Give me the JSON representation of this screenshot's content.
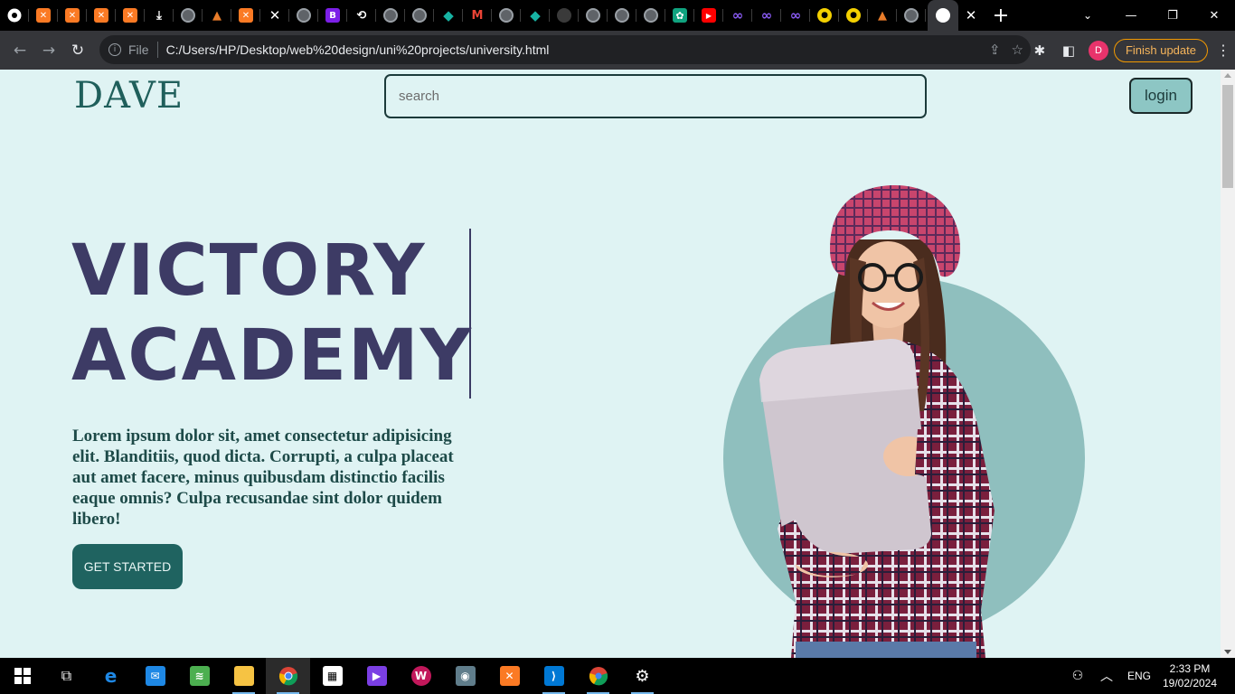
{
  "browser": {
    "tabs": [
      {
        "icon": "chrome-icon"
      },
      {
        "icon": "xampp-icon"
      },
      {
        "icon": "xampp-icon"
      },
      {
        "icon": "xampp-icon"
      },
      {
        "icon": "xampp-icon"
      },
      {
        "icon": "download-icon"
      },
      {
        "icon": "globe-icon"
      },
      {
        "icon": "matlab-icon"
      },
      {
        "icon": "xampp-icon"
      },
      {
        "icon": "x-icon"
      },
      {
        "icon": "globe-icon"
      },
      {
        "icon": "bootstrap-icon",
        "glyph": "B"
      },
      {
        "icon": "history-icon"
      },
      {
        "icon": "globe-icon"
      },
      {
        "icon": "globe-icon"
      },
      {
        "icon": "teal-diamond-icon"
      },
      {
        "icon": "gmail-icon",
        "glyph": "M"
      },
      {
        "icon": "globe-icon"
      },
      {
        "icon": "teal-diamond-icon"
      },
      {
        "icon": "github-icon"
      },
      {
        "icon": "globe-icon"
      },
      {
        "icon": "globe-icon"
      },
      {
        "icon": "globe-icon"
      },
      {
        "icon": "chatgpt-icon"
      },
      {
        "icon": "youtube-icon"
      },
      {
        "icon": "infinity-icon"
      },
      {
        "icon": "infinity-icon"
      },
      {
        "icon": "infinity-icon"
      },
      {
        "icon": "owl-icon"
      },
      {
        "icon": "owl-icon"
      },
      {
        "icon": "matlab-icon"
      },
      {
        "icon": "globe-icon"
      }
    ],
    "active_tab_icon": "google-lens-icon",
    "address_scheme": "File",
    "url": "C:/Users/HP/Desktop/web%20design/uni%20projects/university.html",
    "profile_initial": "D",
    "finish_update_label": "Finish update"
  },
  "page": {
    "logo": "DAVE",
    "search": {
      "placeholder": "search",
      "value": ""
    },
    "login_label": "login",
    "hero": {
      "title_line1": "VICTORY",
      "title_line2": "ACADEMY",
      "text": "Lorem ipsum dolor sit, amet consectetur adipisicing elit. Blanditiis, quod dicta. Corrupti, a culpa placeat aut amet facere, minus quibusdam distinctio facilis eaque omnis? Culpa recusandae sint dolor quidem libero!",
      "cta_label": "GET STARTED",
      "image": "student-with-laptop"
    },
    "colors": {
      "background": "#dff3f3",
      "title": "#3d3b65",
      "accent": "#1f6360",
      "circle": "#8fbfbe",
      "login_bg": "#8dc6c4"
    }
  },
  "taskbar": {
    "apps": [
      {
        "name": "start-icon"
      },
      {
        "name": "task-view-icon"
      },
      {
        "name": "edge-icon"
      },
      {
        "name": "mail-icon"
      },
      {
        "name": "green-app-icon"
      },
      {
        "name": "file-explorer-icon"
      },
      {
        "name": "chrome-icon",
        "active": true
      },
      {
        "name": "store-icon"
      },
      {
        "name": "video-editor-icon"
      },
      {
        "name": "wps-icon"
      },
      {
        "name": "camera-icon"
      },
      {
        "name": "xampp-icon"
      },
      {
        "name": "vscode-icon"
      },
      {
        "name": "chrome-profile-icon"
      },
      {
        "name": "settings-icon"
      }
    ],
    "language": "ENG",
    "time": "2:33 PM",
    "date": "19/02/2024"
  }
}
